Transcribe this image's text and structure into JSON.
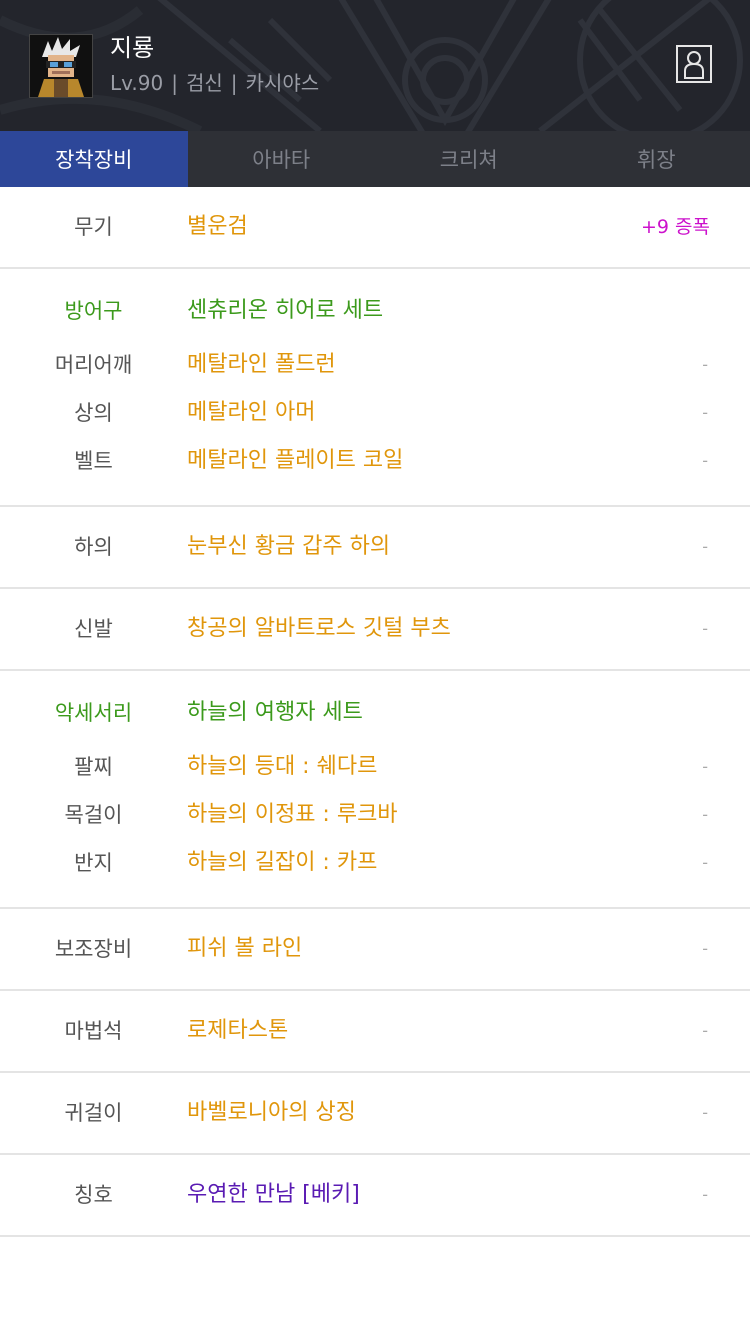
{
  "header": {
    "name": "지룡",
    "level": "Lv.90",
    "job": "검신",
    "server": "카시야스",
    "separator": "|"
  },
  "tabs": [
    {
      "label": "장착장비",
      "active": true
    },
    {
      "label": "아바타",
      "active": false
    },
    {
      "label": "크리쳐",
      "active": false
    },
    {
      "label": "휘장",
      "active": false
    }
  ],
  "equipment": {
    "weapon": {
      "category": "무기",
      "name": "별운검",
      "extra": "+9 증폭"
    },
    "armor_set": {
      "category": "방어구",
      "name": "센츄리온 히어로 세트"
    },
    "shoulder": {
      "category": "머리어깨",
      "name": "메탈라인 폴드런",
      "extra": "-"
    },
    "top": {
      "category": "상의",
      "name": "메탈라인 아머",
      "extra": "-"
    },
    "belt": {
      "category": "벨트",
      "name": "메탈라인 플레이트 코일",
      "extra": "-"
    },
    "bottom": {
      "category": "하의",
      "name": "눈부신 황금 갑주 하의",
      "extra": "-"
    },
    "shoes": {
      "category": "신발",
      "name": "창공의 알바트로스 깃털 부츠",
      "extra": "-"
    },
    "acc_set": {
      "category": "악세서리",
      "name": "하늘의 여행자 세트"
    },
    "bracelet": {
      "category": "팔찌",
      "name": "하늘의 등대 : 쉐다르",
      "extra": "-"
    },
    "necklace": {
      "category": "목걸이",
      "name": "하늘의 이정표 : 루크바",
      "extra": "-"
    },
    "ring": {
      "category": "반지",
      "name": "하늘의 길잡이 : 카프",
      "extra": "-"
    },
    "support": {
      "category": "보조장비",
      "name": "피쉬 볼 라인",
      "extra": "-"
    },
    "magic_stone": {
      "category": "마법석",
      "name": "로제타스톤",
      "extra": "-"
    },
    "earring": {
      "category": "귀걸이",
      "name": "바벨로니아의 상징",
      "extra": "-"
    },
    "title": {
      "category": "칭호",
      "name": "우연한 만남 [베키]",
      "extra": "-"
    }
  },
  "colors": {
    "item_unique": "#e0960b",
    "set_green": "#3c9a1c",
    "enhance_magenta": "#cc11cc",
    "title_purple": "#5a1bb3",
    "tab_active": "#2d4799"
  },
  "icons": [
    "character-avatar-icon",
    "profile-person-icon"
  ]
}
